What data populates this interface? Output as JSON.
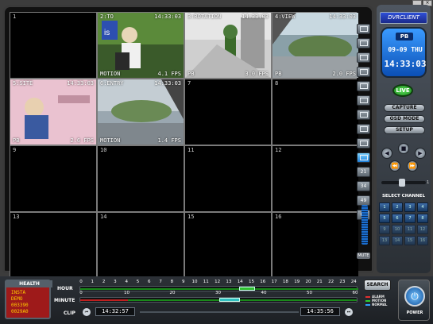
{
  "window": {
    "minimize_label": "_",
    "close_label": "×"
  },
  "brand": "DVRCLIENT",
  "clock": {
    "mode": "PB",
    "date": "09-09 THU",
    "time": "14:33:03"
  },
  "live_label": "LIVE",
  "buttons": {
    "capture": "CAPTURE",
    "osd_mode": "OSD MODE",
    "setup": "SETUP",
    "search": "SEARCH"
  },
  "view_modes": [
    "",
    "",
    "",
    "",
    "",
    "",
    "",
    "",
    "",
    "",
    "21",
    "34",
    "49",
    "64"
  ],
  "mute_label": "MUTE",
  "select_channel_title": "SELECT CHANNEL",
  "channels": [
    "1",
    "2",
    "3",
    "4",
    "5",
    "6",
    "7",
    "8",
    "9",
    "10",
    "11",
    "12",
    "13",
    "14",
    "15",
    "16"
  ],
  "speed_label": "1",
  "cameras": [
    {
      "num": "1",
      "title": "",
      "time": "",
      "label": "",
      "fps": ""
    },
    {
      "num": "",
      "title": "2:TO",
      "time": "14:33:03",
      "label": "MOTION",
      "fps": "4.1 FPS"
    },
    {
      "num": "",
      "title": "3:ROTATION",
      "time": "14:33:03",
      "label": "PB",
      "fps": "3.0 FPS"
    },
    {
      "num": "",
      "title": "4:VIEW",
      "time": "14:33:03",
      "label": "PB",
      "fps": "2.0 FPS"
    },
    {
      "num": "",
      "title": "5:SITE",
      "time": "14:33:03",
      "label": "PB",
      "fps": "2.6 FPS"
    },
    {
      "num": "",
      "title": "6:ENTRY",
      "time": "14:33:03",
      "label": "MOTION",
      "fps": "1.4 FPS"
    },
    {
      "num": "7",
      "title": "",
      "time": "",
      "label": "",
      "fps": ""
    },
    {
      "num": "8",
      "title": "",
      "time": "",
      "label": "",
      "fps": ""
    },
    {
      "num": "9",
      "title": "",
      "time": "",
      "label": "",
      "fps": ""
    },
    {
      "num": "10",
      "title": "",
      "time": "",
      "label": "",
      "fps": ""
    },
    {
      "num": "11",
      "title": "",
      "time": "",
      "label": "",
      "fps": ""
    },
    {
      "num": "12",
      "title": "",
      "time": "",
      "label": "",
      "fps": ""
    },
    {
      "num": "13",
      "title": "",
      "time": "",
      "label": "",
      "fps": ""
    },
    {
      "num": "14",
      "title": "",
      "time": "",
      "label": "",
      "fps": ""
    },
    {
      "num": "15",
      "title": "",
      "time": "",
      "label": "",
      "fps": ""
    },
    {
      "num": "16",
      "title": "",
      "time": "",
      "label": "",
      "fps": ""
    }
  ],
  "health": {
    "title": "HEALTH",
    "lines": [
      "INSTA",
      "DEMO",
      "003390",
      "0029A0"
    ]
  },
  "timeline": {
    "hour_label": "HOUR",
    "minute_label": "MINUTE",
    "clip_label": "CLIP",
    "hours": [
      "0",
      "1",
      "2",
      "3",
      "4",
      "5",
      "6",
      "7",
      "8",
      "9",
      "10",
      "11",
      "12",
      "13",
      "14",
      "15",
      "16",
      "17",
      "18",
      "19",
      "20",
      "21",
      "22",
      "23",
      "24"
    ],
    "minutes": [
      "0",
      "10",
      "20",
      "30",
      "40",
      "50",
      "60"
    ],
    "clip_start": "14:32:57",
    "clip_end": "14:35:56"
  },
  "legend": [
    "ALARM",
    "MOTION",
    "NORMAL"
  ],
  "legend_colors": [
    "#e03030",
    "#30d030",
    "#30a0ff"
  ],
  "power_label": "POWER"
}
